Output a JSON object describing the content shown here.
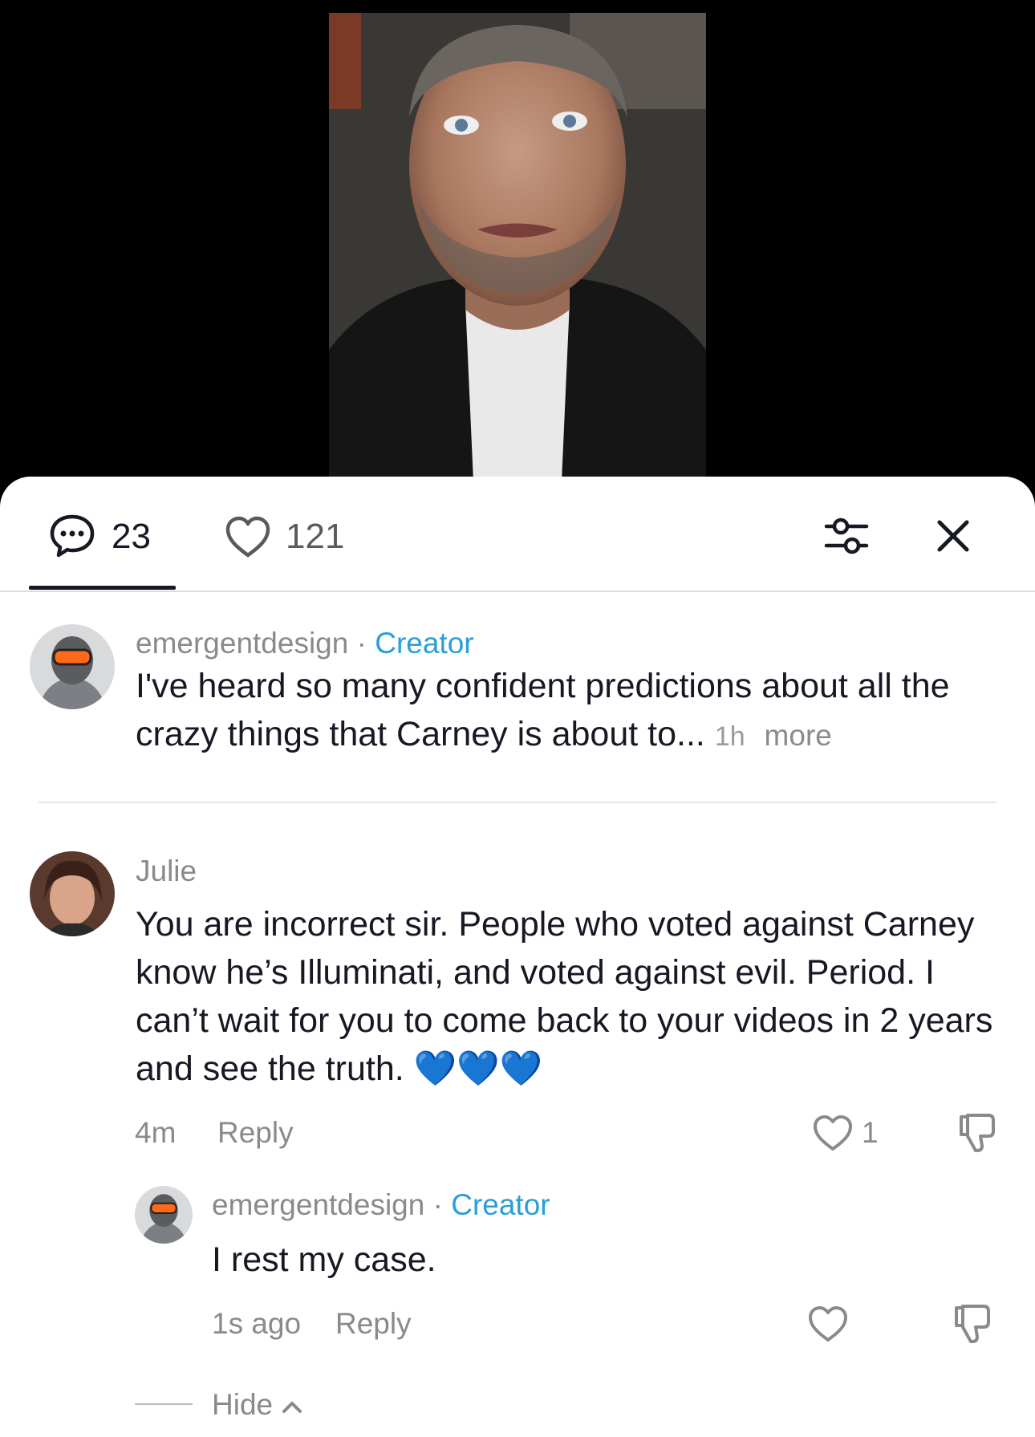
{
  "header": {
    "comment_count": "23",
    "like_count": "121"
  },
  "comments": [
    {
      "username": "emergentdesign",
      "separator": "·",
      "badge": "Creator",
      "text": "I've heard so many confident predictions about all the crazy things that Carney is about to...",
      "time": "1h",
      "more_label": "more"
    },
    {
      "username": "Julie",
      "text": "You are incorrect sir. People who voted against Carney know he’s Illuminati, and voted against evil. Period. I can’t wait for you to come back to your videos in 2 years and see the truth. 💙💙💙",
      "time": "4m",
      "reply_label": "Reply",
      "like_count": "1",
      "replies": [
        {
          "username": "emergentdesign",
          "separator": "·",
          "badge": "Creator",
          "text": "I rest my case.",
          "time": "1s ago",
          "reply_label": "Reply"
        }
      ],
      "hide_label": "Hide"
    }
  ],
  "colors": {
    "creator_badge": "#2a9fd6",
    "heart_emoji": "#0a6cff",
    "text_primary": "#161823",
    "text_secondary": "#8a8a8a"
  }
}
